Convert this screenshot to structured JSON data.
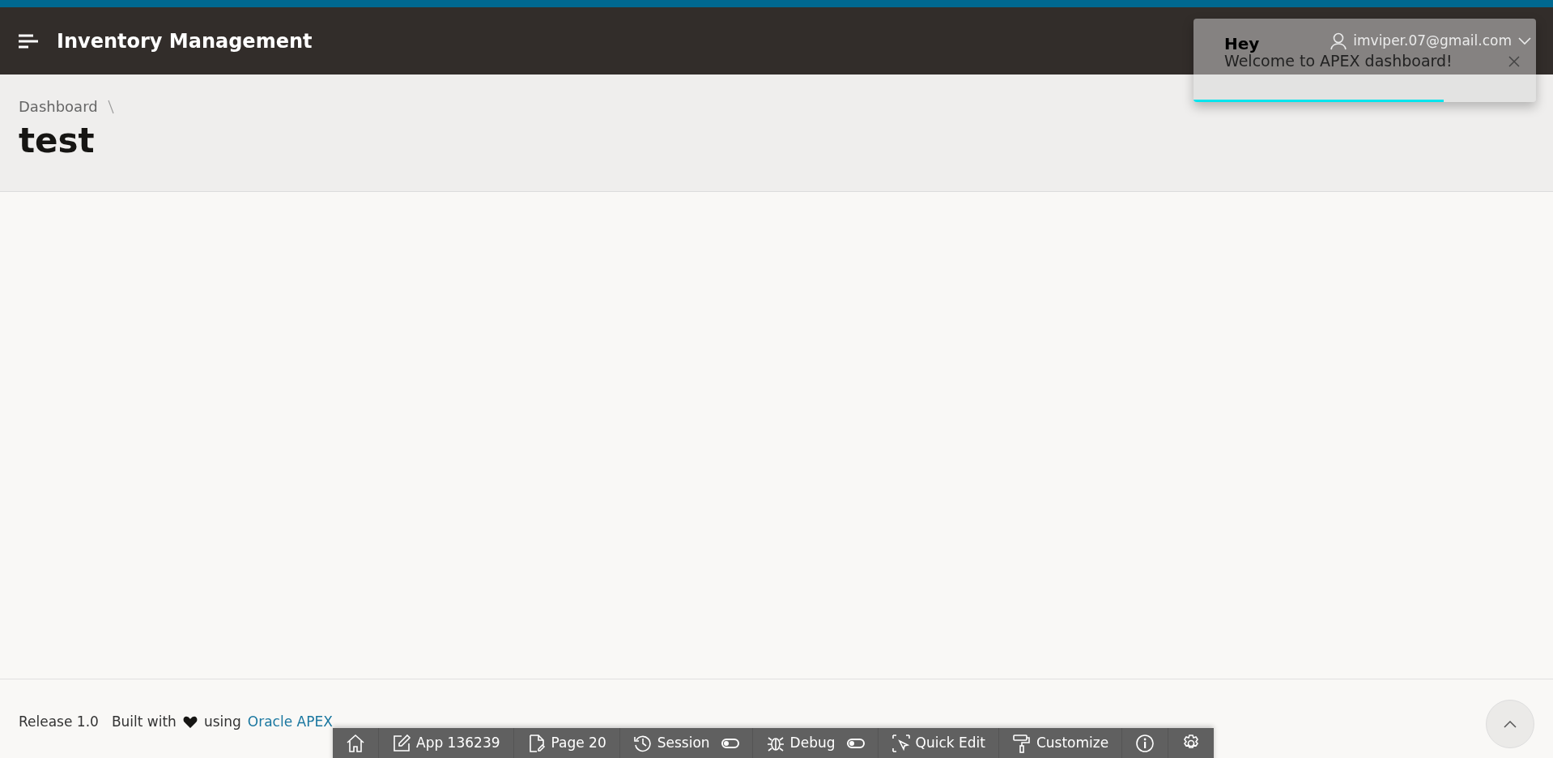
{
  "header": {
    "title": "Inventory Management",
    "user": "imviper.07@gmail.com"
  },
  "toast": {
    "title": "Hey",
    "message": "Welcome to APEX dashboard!",
    "level": 0.73
  },
  "breadcrumb": [
    "Dashboard"
  ],
  "page_title": "test",
  "footer": {
    "release": "Release 1.0",
    "built_with": "Built with",
    "using": "using",
    "link": "Oracle APEX"
  },
  "dev_toolbar": [
    {
      "kind": "icon"
    },
    {
      "kind": "button",
      "label": "App 136239"
    },
    {
      "kind": "button",
      "label": "Page 20"
    },
    {
      "kind": "toggle",
      "label": "Session",
      "on": false
    },
    {
      "kind": "toggle",
      "label": "Debug",
      "on": false
    },
    {
      "kind": "button",
      "label": "Quick Edit"
    },
    {
      "kind": "button",
      "label": "Customize"
    },
    {
      "kind": "icon"
    },
    {
      "kind": "icon"
    }
  ]
}
